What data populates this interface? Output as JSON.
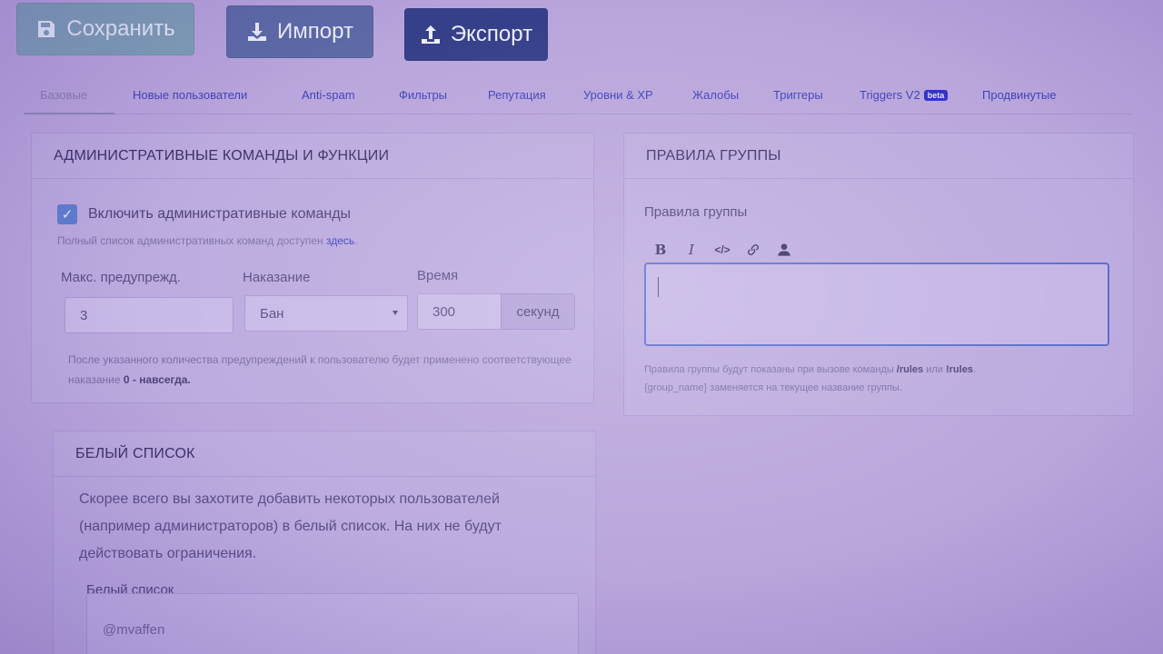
{
  "toolbar": {
    "save_label": "Сохранить",
    "import_label": "Импорт",
    "export_label": "Экспорт"
  },
  "tabs": [
    {
      "label": "Базовые",
      "active": true
    },
    {
      "label": "Новые пользователи"
    },
    {
      "label": "Anti-spam"
    },
    {
      "label": "Фильтры"
    },
    {
      "label": "Репутация"
    },
    {
      "label": "Уровни & XP"
    },
    {
      "label": "Жалобы"
    },
    {
      "label": "Триггеры"
    },
    {
      "label": "Triggers V2",
      "badge": "beta"
    },
    {
      "label": "Продвинутые"
    }
  ],
  "admin": {
    "title": "АДМИНИСТРАТИВНЫЕ КОМАНДЫ И ФУНКЦИИ",
    "enable_label": "Включить административные команды",
    "enabled": true,
    "hint_prefix": "Полный список административных команд доступен ",
    "hint_link": "здесь",
    "hint_suffix": ".",
    "max_warn_label": "Макс. предупрежд.",
    "max_warn_value": "3",
    "punish_label": "Наказание",
    "punish_value": "Бан",
    "time_label": "Время",
    "time_value": "300",
    "time_unit": "секунд",
    "footer_text": "После указанного количества предупреждений к пользователю будет применено соответствующее наказание ",
    "footer_bold": "0 - навсегда."
  },
  "rules": {
    "title": "ПРАВИЛА ГРУППЫ",
    "label": "Правила группы",
    "toolbar": [
      "bold-icon",
      "italic-icon",
      "code-icon",
      "link-icon",
      "user-icon"
    ],
    "editor_value": "",
    "hint_a": "Правила группы будут показаны при вызове команды ",
    "hint_cmd1": "/rules",
    "hint_or": " или ",
    "hint_cmd2": "!rules",
    "hint_b": ".",
    "hint_c": "{group_name} заменяется на текущее название группы."
  },
  "whitelist": {
    "title": "БЕЛЫЙ СПИСОК",
    "description": "Скорее всего вы захотите добавить некоторых пользователей (например администраторов) в белый список. На них не будут действовать ограничения.",
    "label": "Белый список",
    "items": [
      "@mvaffen"
    ]
  },
  "colors": {
    "save": "#7fa1b6",
    "import": "#5d6ba6",
    "export": "#36408a",
    "link": "#3f43b8",
    "beta": "#3230c8"
  }
}
